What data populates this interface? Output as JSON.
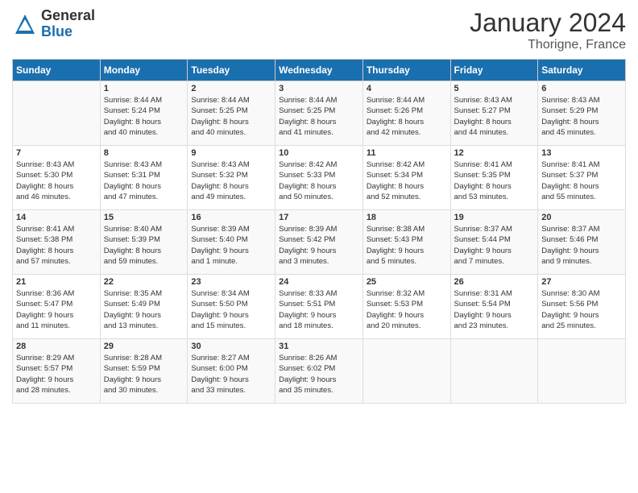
{
  "header": {
    "logo_general": "General",
    "logo_blue": "Blue",
    "title": "January 2024",
    "subtitle": "Thorigne, France"
  },
  "weekdays": [
    "Sunday",
    "Monday",
    "Tuesday",
    "Wednesday",
    "Thursday",
    "Friday",
    "Saturday"
  ],
  "weeks": [
    [
      {
        "day": "",
        "info": ""
      },
      {
        "day": "1",
        "info": "Sunrise: 8:44 AM\nSunset: 5:24 PM\nDaylight: 8 hours\nand 40 minutes."
      },
      {
        "day": "2",
        "info": "Sunrise: 8:44 AM\nSunset: 5:25 PM\nDaylight: 8 hours\nand 40 minutes."
      },
      {
        "day": "3",
        "info": "Sunrise: 8:44 AM\nSunset: 5:25 PM\nDaylight: 8 hours\nand 41 minutes."
      },
      {
        "day": "4",
        "info": "Sunrise: 8:44 AM\nSunset: 5:26 PM\nDaylight: 8 hours\nand 42 minutes."
      },
      {
        "day": "5",
        "info": "Sunrise: 8:43 AM\nSunset: 5:27 PM\nDaylight: 8 hours\nand 44 minutes."
      },
      {
        "day": "6",
        "info": "Sunrise: 8:43 AM\nSunset: 5:29 PM\nDaylight: 8 hours\nand 45 minutes."
      }
    ],
    [
      {
        "day": "7",
        "info": "Sunrise: 8:43 AM\nSunset: 5:30 PM\nDaylight: 8 hours\nand 46 minutes."
      },
      {
        "day": "8",
        "info": "Sunrise: 8:43 AM\nSunset: 5:31 PM\nDaylight: 8 hours\nand 47 minutes."
      },
      {
        "day": "9",
        "info": "Sunrise: 8:43 AM\nSunset: 5:32 PM\nDaylight: 8 hours\nand 49 minutes."
      },
      {
        "day": "10",
        "info": "Sunrise: 8:42 AM\nSunset: 5:33 PM\nDaylight: 8 hours\nand 50 minutes."
      },
      {
        "day": "11",
        "info": "Sunrise: 8:42 AM\nSunset: 5:34 PM\nDaylight: 8 hours\nand 52 minutes."
      },
      {
        "day": "12",
        "info": "Sunrise: 8:41 AM\nSunset: 5:35 PM\nDaylight: 8 hours\nand 53 minutes."
      },
      {
        "day": "13",
        "info": "Sunrise: 8:41 AM\nSunset: 5:37 PM\nDaylight: 8 hours\nand 55 minutes."
      }
    ],
    [
      {
        "day": "14",
        "info": "Sunrise: 8:41 AM\nSunset: 5:38 PM\nDaylight: 8 hours\nand 57 minutes."
      },
      {
        "day": "15",
        "info": "Sunrise: 8:40 AM\nSunset: 5:39 PM\nDaylight: 8 hours\nand 59 minutes."
      },
      {
        "day": "16",
        "info": "Sunrise: 8:39 AM\nSunset: 5:40 PM\nDaylight: 9 hours\nand 1 minute."
      },
      {
        "day": "17",
        "info": "Sunrise: 8:39 AM\nSunset: 5:42 PM\nDaylight: 9 hours\nand 3 minutes."
      },
      {
        "day": "18",
        "info": "Sunrise: 8:38 AM\nSunset: 5:43 PM\nDaylight: 9 hours\nand 5 minutes."
      },
      {
        "day": "19",
        "info": "Sunrise: 8:37 AM\nSunset: 5:44 PM\nDaylight: 9 hours\nand 7 minutes."
      },
      {
        "day": "20",
        "info": "Sunrise: 8:37 AM\nSunset: 5:46 PM\nDaylight: 9 hours\nand 9 minutes."
      }
    ],
    [
      {
        "day": "21",
        "info": "Sunrise: 8:36 AM\nSunset: 5:47 PM\nDaylight: 9 hours\nand 11 minutes."
      },
      {
        "day": "22",
        "info": "Sunrise: 8:35 AM\nSunset: 5:49 PM\nDaylight: 9 hours\nand 13 minutes."
      },
      {
        "day": "23",
        "info": "Sunrise: 8:34 AM\nSunset: 5:50 PM\nDaylight: 9 hours\nand 15 minutes."
      },
      {
        "day": "24",
        "info": "Sunrise: 8:33 AM\nSunset: 5:51 PM\nDaylight: 9 hours\nand 18 minutes."
      },
      {
        "day": "25",
        "info": "Sunrise: 8:32 AM\nSunset: 5:53 PM\nDaylight: 9 hours\nand 20 minutes."
      },
      {
        "day": "26",
        "info": "Sunrise: 8:31 AM\nSunset: 5:54 PM\nDaylight: 9 hours\nand 23 minutes."
      },
      {
        "day": "27",
        "info": "Sunrise: 8:30 AM\nSunset: 5:56 PM\nDaylight: 9 hours\nand 25 minutes."
      }
    ],
    [
      {
        "day": "28",
        "info": "Sunrise: 8:29 AM\nSunset: 5:57 PM\nDaylight: 9 hours\nand 28 minutes."
      },
      {
        "day": "29",
        "info": "Sunrise: 8:28 AM\nSunset: 5:59 PM\nDaylight: 9 hours\nand 30 minutes."
      },
      {
        "day": "30",
        "info": "Sunrise: 8:27 AM\nSunset: 6:00 PM\nDaylight: 9 hours\nand 33 minutes."
      },
      {
        "day": "31",
        "info": "Sunrise: 8:26 AM\nSunset: 6:02 PM\nDaylight: 9 hours\nand 35 minutes."
      },
      {
        "day": "",
        "info": ""
      },
      {
        "day": "",
        "info": ""
      },
      {
        "day": "",
        "info": ""
      }
    ]
  ]
}
